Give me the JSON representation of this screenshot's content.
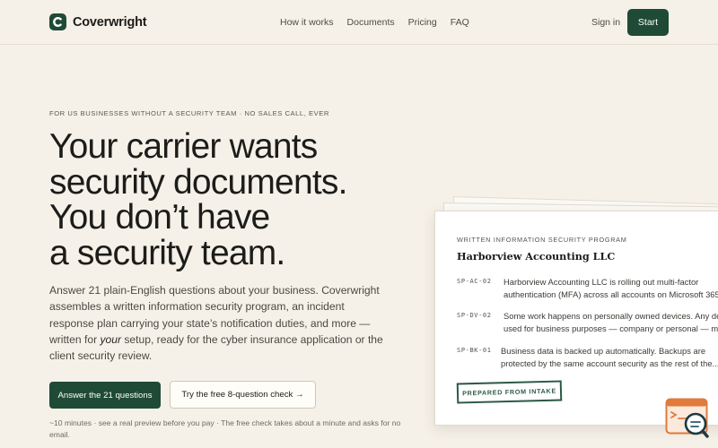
{
  "header": {
    "brand": "Coverwright",
    "nav": [
      "How it works",
      "Documents",
      "Pricing",
      "FAQ"
    ],
    "signin": "Sign in",
    "start": "Start"
  },
  "hero": {
    "eyebrow": "FOR US BUSINESSES WITHOUT A SECURITY TEAM · NO SALES CALL, EVER",
    "headline": [
      "Your carrier wants",
      "security documents.",
      "You don’t have",
      "a security team."
    ],
    "lede_before": "Answer 21 plain-English questions about your business. Coverwright assembles a written information security program, an incident response plan carrying your state’s notification duties, and more — written for ",
    "lede_em": "your",
    "lede_after": " setup, ready for the cyber insurance application or the client security review.",
    "primary_cta": "Answer the 21 questions",
    "secondary_cta": "Try the free 8-question check →",
    "footnote": "~10 minutes · see a real preview before you pay · The free check takes about a minute and asks for no email."
  },
  "preview": {
    "eyebrow": "WRITTEN INFORMATION SECURITY PROGRAM",
    "title": "Harborview Accounting LLC",
    "rows": [
      {
        "code": "SP-AC-02",
        "lines": [
          "Harborview Accounting LLC is rolling out multi-factor",
          "authentication (MFA) across all accounts on Microsoft 365"
        ]
      },
      {
        "code": "SP-DV-02",
        "lines": [
          "Some work happens on personally owned devices. Any dev",
          "used for business purposes — company or personal — mus"
        ]
      },
      {
        "code": "SP-BK-01",
        "lines": [
          "Business data is backed up automatically. Backups are",
          "protected by the same account security as the rest of the..."
        ]
      }
    ],
    "stamp": "PREPARED FROM INTAKE"
  },
  "colors": {
    "background": "#f6f1e8",
    "brand_green": "#1f4a36",
    "stamp_green": "#2c5a44",
    "chat_orange": "#e07a3d"
  },
  "icons": {
    "logo": "letter-c-logo-icon",
    "chat": "chat-search-icon"
  }
}
